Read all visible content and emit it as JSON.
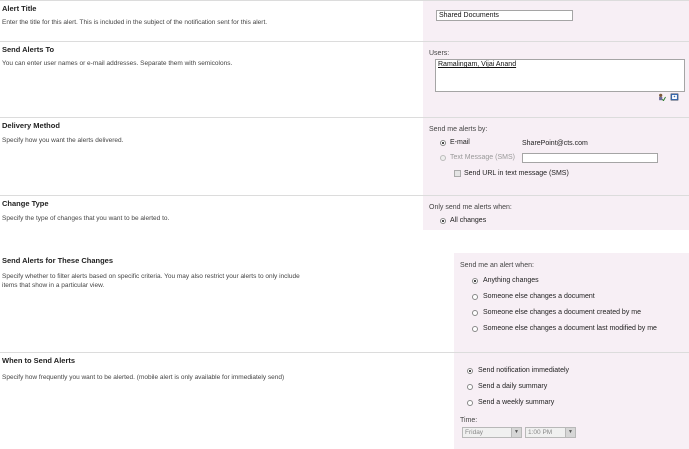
{
  "alert_title": {
    "title": "Alert Title",
    "description": "Enter the title for this alert. This is included in the subject of the notification sent for this alert.",
    "value": "Shared Documents"
  },
  "send_alerts_to": {
    "title": "Send Alerts To",
    "description": "You can enter user names or e-mail addresses. Separate them with semicolons.",
    "users_label": "Users:",
    "users_value": "Ramalingam, Vijai Anand",
    "icons": [
      "check-names-icon",
      "address-book-icon"
    ]
  },
  "delivery_method": {
    "title": "Delivery Method",
    "description": "Specify how you want the alerts delivered.",
    "prompt": "Send me alerts by:",
    "email_label": "E-mail",
    "email_address": "SharePoint@cts.com",
    "sms_label": "Text Message (SMS)",
    "sms_value": "",
    "send_url_label": "Send URL in text message (SMS)"
  },
  "change_type": {
    "title": "Change Type",
    "description": "Specify the type of changes that you want to be alerted to.",
    "prompt": "Only send me alerts when:",
    "option": "All changes"
  },
  "filter_changes": {
    "title": "Send Alerts for These Changes",
    "description_line1": "Specify whether to filter alerts based on specific criteria. You may also restrict your alerts to only include",
    "description_line2": "items that show in a particular view.",
    "prompt": "Send me an alert when:",
    "options": [
      "Anything changes",
      "Someone else changes a document",
      "Someone else changes a document created by me",
      "Someone else changes a document last modified by me"
    ]
  },
  "when_to_send": {
    "title": "When to Send Alerts",
    "description": "Specify how frequently you want to be alerted. (mobile alert is only available for immediately send)",
    "options": [
      "Send notification immediately",
      "Send a daily summary",
      "Send a weekly summary"
    ],
    "time_label": "Time:",
    "day_value": "Friday",
    "time_value": "1:00 PM"
  }
}
